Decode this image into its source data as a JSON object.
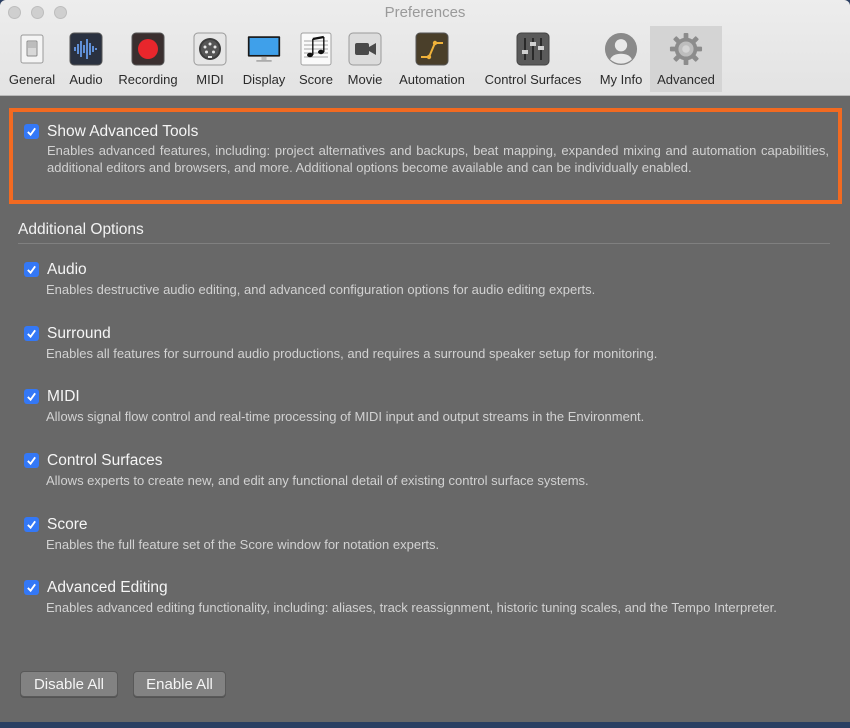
{
  "window": {
    "title": "Preferences"
  },
  "toolbar": {
    "items": [
      {
        "label": "General",
        "icon": "general-switch-icon"
      },
      {
        "label": "Audio",
        "icon": "audio-waveform-icon"
      },
      {
        "label": "Recording",
        "icon": "record-icon"
      },
      {
        "label": "MIDI",
        "icon": "midi-port-icon"
      },
      {
        "label": "Display",
        "icon": "display-icon"
      },
      {
        "label": "Score",
        "icon": "score-notes-icon"
      },
      {
        "label": "Movie",
        "icon": "movie-camera-icon"
      },
      {
        "label": "Automation",
        "icon": "automation-curve-icon"
      },
      {
        "label": "Control Surfaces",
        "icon": "control-surface-faders-icon"
      },
      {
        "label": "My Info",
        "icon": "user-icon"
      },
      {
        "label": "Advanced",
        "icon": "gear-icon",
        "selected": true
      }
    ]
  },
  "advanced_tools": {
    "title": "Show Advanced Tools",
    "checked": true,
    "description": "Enables advanced features, including: project alternatives and backups, beat mapping, expanded mixing and automation capabilities, additional editors and browsers, and more. Additional options become available and can be individually enabled."
  },
  "additional_options": {
    "heading": "Additional Options",
    "options": [
      {
        "title": "Audio",
        "checked": true,
        "description": "Enables destructive audio editing, and advanced configuration options for audio editing experts."
      },
      {
        "title": "Surround",
        "checked": true,
        "description": "Enables all features for surround audio productions, and requires a surround speaker setup for monitoring."
      },
      {
        "title": "MIDI",
        "checked": true,
        "description": "Allows signal flow control and real-time processing of MIDI input and output streams in the Environment."
      },
      {
        "title": "Control Surfaces",
        "checked": true,
        "description": "Allows experts to create new, and edit any functional detail of existing control surface systems."
      },
      {
        "title": "Score",
        "checked": true,
        "description": "Enables the full feature set of the Score window for notation experts."
      },
      {
        "title": "Advanced Editing",
        "checked": true,
        "description": "Enables advanced editing functionality, including: aliases, track reassignment, historic tuning scales, and the Tempo Interpreter."
      }
    ]
  },
  "buttons": {
    "disable_all": "Disable All",
    "enable_all": "Enable All"
  },
  "colors": {
    "accent": "#3478f6",
    "highlight": "#f26a21",
    "panel": "#686868"
  }
}
